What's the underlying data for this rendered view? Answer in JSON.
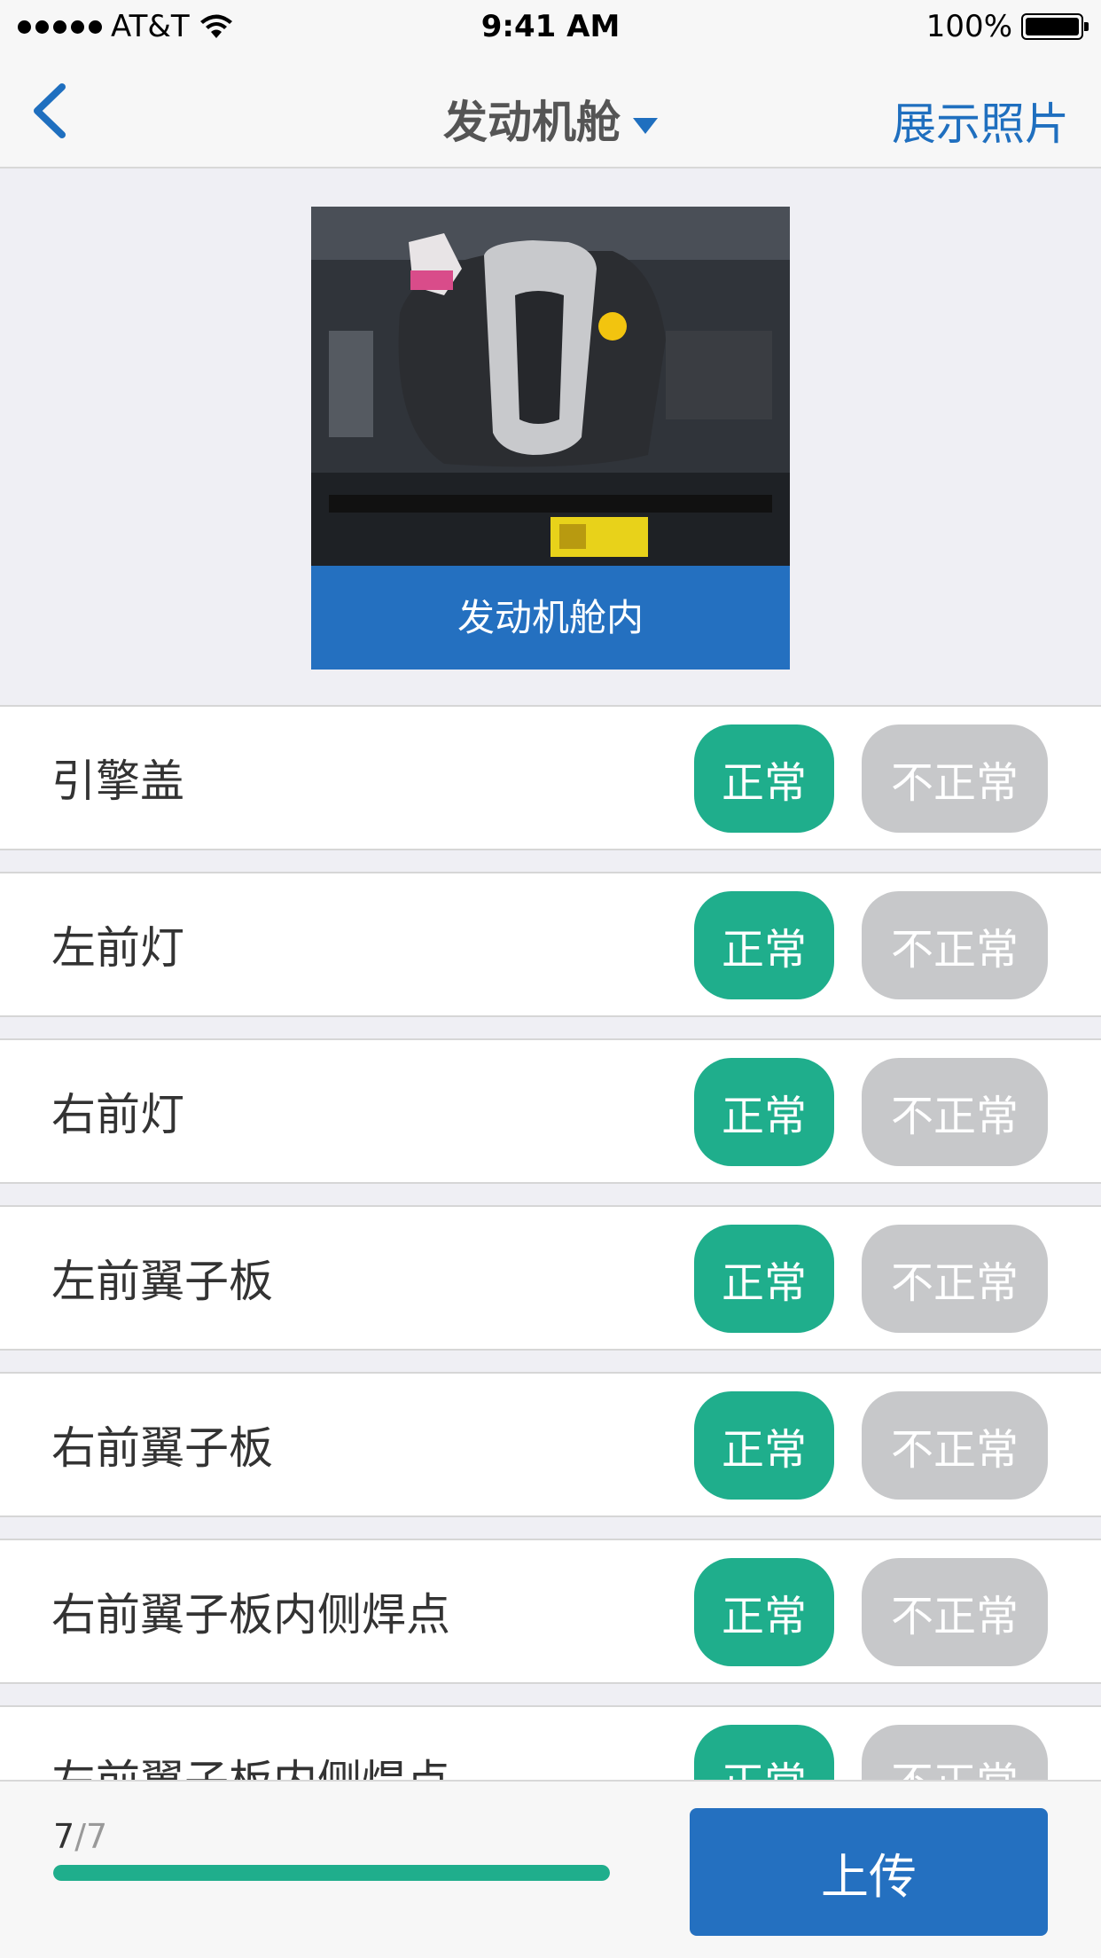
{
  "status_bar": {
    "carrier": "AT&T",
    "time": "9:41 AM",
    "battery": "100%"
  },
  "nav": {
    "title": "发动机舱",
    "right_action": "展示照片"
  },
  "photo": {
    "caption": "发动机舱内"
  },
  "buttons": {
    "normal": "正常",
    "abnormal": "不正常"
  },
  "items": [
    {
      "label": "引擎盖"
    },
    {
      "label": "左前灯"
    },
    {
      "label": "右前灯"
    },
    {
      "label": "左前翼子板"
    },
    {
      "label": "右前翼子板"
    },
    {
      "label": "右前翼子板内侧焊点"
    },
    {
      "label": "左前翼子板内侧焊点"
    }
  ],
  "progress": {
    "current": "7",
    "separator": "/",
    "total": "7",
    "fraction": 1.0
  },
  "upload": {
    "label": "上传"
  },
  "colors": {
    "accent_blue": "#2470c0",
    "normal_green": "#1fae8c",
    "abnormal_gray": "#c7c8ca"
  }
}
